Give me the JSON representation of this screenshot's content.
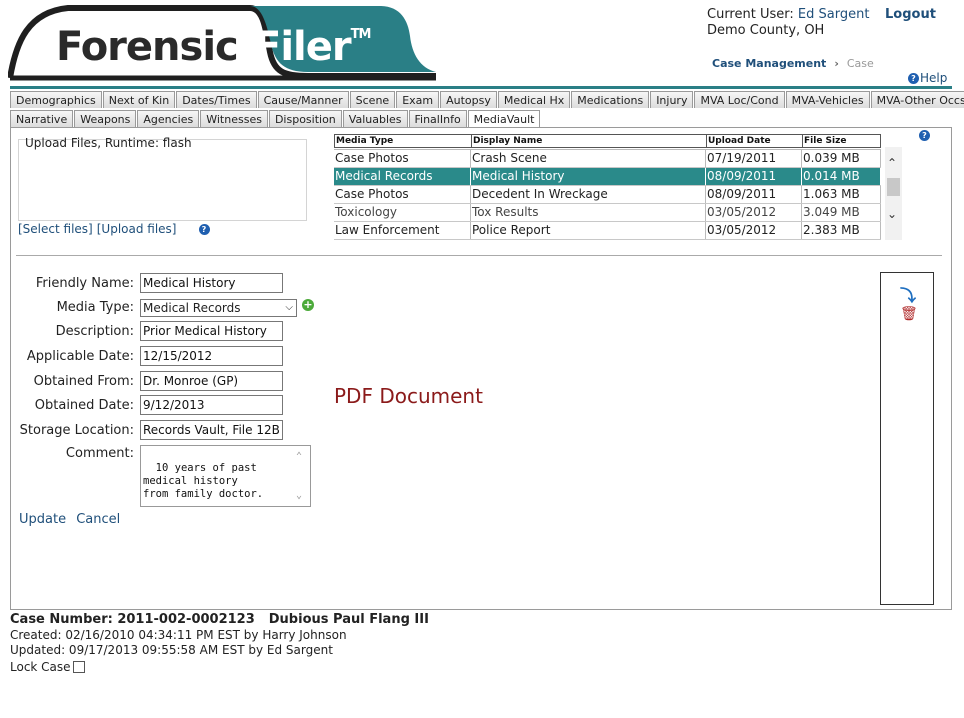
{
  "app": {
    "logo_left": "Forensic",
    "logo_right": "Filer",
    "logo_tm": "TM"
  },
  "header": {
    "user_label": "Current User:",
    "user_name": "Ed Sargent",
    "logout": "Logout",
    "county": "Demo County, OH",
    "breadcrumb": [
      "Case Management",
      "Case"
    ],
    "help": "Help",
    "accent": "#2a7f86"
  },
  "tabs_row1": [
    "Demographics",
    "Next of Kin",
    "Dates/Times",
    "Cause/Manner",
    "Scene",
    "Exam",
    "Autopsy",
    "Medical Hx",
    "Medications",
    "Injury",
    "MVA Loc/Cond",
    "MVA-Vehicles",
    "MVA-Other Occs"
  ],
  "tabs_row2": [
    "Narrative",
    "Weapons",
    "Agencies",
    "Witnesses",
    "Disposition",
    "Valuables",
    "FinalInfo",
    "MediaVault"
  ],
  "active_tab": "MediaVault",
  "upload": {
    "runtime_text": "Upload Files, Runtime: flash",
    "select_files": "[Select files]",
    "upload_files": "[Upload files]"
  },
  "grid": {
    "columns": [
      "Media Type",
      "Display Name",
      "Upload Date",
      "File Size"
    ],
    "rows": [
      [
        "Case Photos",
        "Crash Scene",
        "07/19/2011",
        "0.039 MB"
      ],
      [
        "Medical Records",
        "Medical History",
        "08/09/2011",
        "0.014 MB"
      ],
      [
        "Case Photos",
        "Decedent In Wreckage",
        "08/09/2011",
        "1.063 MB"
      ],
      [
        "Toxicology",
        "Tox Results",
        "03/05/2012",
        "3.049 MB"
      ],
      [
        "Law Enforcement",
        "Police Report",
        "03/05/2012",
        "2.383 MB"
      ]
    ],
    "selected_index": 1,
    "selected_color": "#2a8a8a"
  },
  "form": {
    "friendly_name": {
      "label": "Friendly Name:",
      "value": "Medical History"
    },
    "media_type": {
      "label": "Media Type:",
      "value": "Medical Records"
    },
    "description": {
      "label": "Description:",
      "value": "Prior Medical History"
    },
    "applicable_date": {
      "label": "Applicable Date:",
      "value": "12/15/2012"
    },
    "obtained_from": {
      "label": "Obtained From:",
      "value": "Dr. Monroe (GP)"
    },
    "obtained_date": {
      "label": "Obtained Date:",
      "value": "9/12/2013"
    },
    "storage_location": {
      "label": "Storage Location:",
      "value": "Records Vault, File 12B"
    },
    "comment": {
      "label": "Comment:",
      "value": "10 years of past\nmedical history\nfrom family doctor."
    },
    "update": "Update",
    "cancel": "Cancel"
  },
  "preview": {
    "text": "PDF Document",
    "color": "#8b1a1a"
  },
  "footer": {
    "case_number": "Case Number: 2011-002-0002123",
    "case_name": "Dubious Paul Flang III",
    "created": "Created: 02/16/2010 04:34:11 PM EST by Harry Johnson",
    "updated": "Updated: 09/17/2013 09:55:58 AM EST by Ed Sargent",
    "lock_case": "Lock Case"
  },
  "icons": {
    "help": "help-icon",
    "add": "add-icon",
    "download": "download-icon",
    "delete": "delete-icon"
  }
}
